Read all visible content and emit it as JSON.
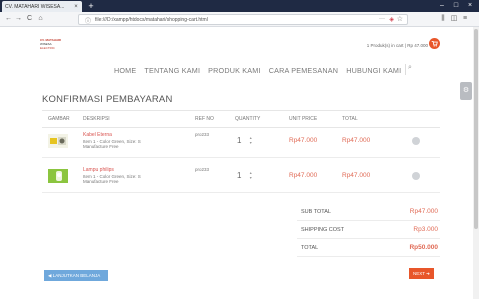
{
  "browser": {
    "tab_title": "CV. MATAHARI WISESA...",
    "tab_close": "×",
    "new_tab": "+",
    "win_min": "–",
    "win_max": "□",
    "win_close": "×",
    "url": "file:///D:/xampp/htdocs/matahari/shopping-cart.html",
    "url_more": "···",
    "back": "←",
    "forward": "→",
    "reload": "C",
    "home": "⌂",
    "library": "⫼",
    "sidebar": "◫",
    "menu": "≡"
  },
  "site": {
    "logo_line1": "CV. MATAHARI",
    "logo_line2": "WISESA",
    "logo_line3": "ELECTRIC",
    "cart_summary": "1 Produk(s) in cart | Rp 47.000",
    "cart_icon": "🛒"
  },
  "nav": {
    "items": [
      "HOME",
      "TENTANG KAMI",
      "PRODUK KAMI",
      "CARA PEMESANAN",
      "HUBUNGI KAMI"
    ],
    "search_icon": "⌕"
  },
  "side_widget": "⚙",
  "page": {
    "title": "KONFIRMASI PEMBAYARAN"
  },
  "table": {
    "headers": [
      "GAMBAR",
      "DESKRIPSI",
      "REF NO",
      "QUANTITY",
      "UNIT PRICE",
      "TOTAL"
    ],
    "rows": [
      {
        "name": "Kabel Eterna",
        "option": "Item 1 - Color Green, Size: S",
        "note": "Manufacture Free",
        "ref": "pro233",
        "qty": "1",
        "unit_price": "Rp47.000",
        "total": "Rp47.000"
      },
      {
        "name": "Lampu philips",
        "option": "Item 1 - Color Green, Size: S",
        "note": "Manufacture Free",
        "ref": "pro233",
        "qty": "1",
        "unit_price": "Rp47.000",
        "total": "Rp47.000"
      }
    ]
  },
  "summary": {
    "subtotal_label": "SUB TOTAL",
    "subtotal": "Rp47.000",
    "shipping_label": "SHIPPING COST",
    "shipping": "Rp3.000",
    "total_label": "TOTAL",
    "total": "Rp50.000"
  },
  "buttons": {
    "back": "◀ LANJUTKAN BELANJA",
    "next": "NEXT ➜"
  },
  "colors": {
    "accent": "#e8562a",
    "price": "#e06a55",
    "back_button": "#6fa8dc"
  }
}
